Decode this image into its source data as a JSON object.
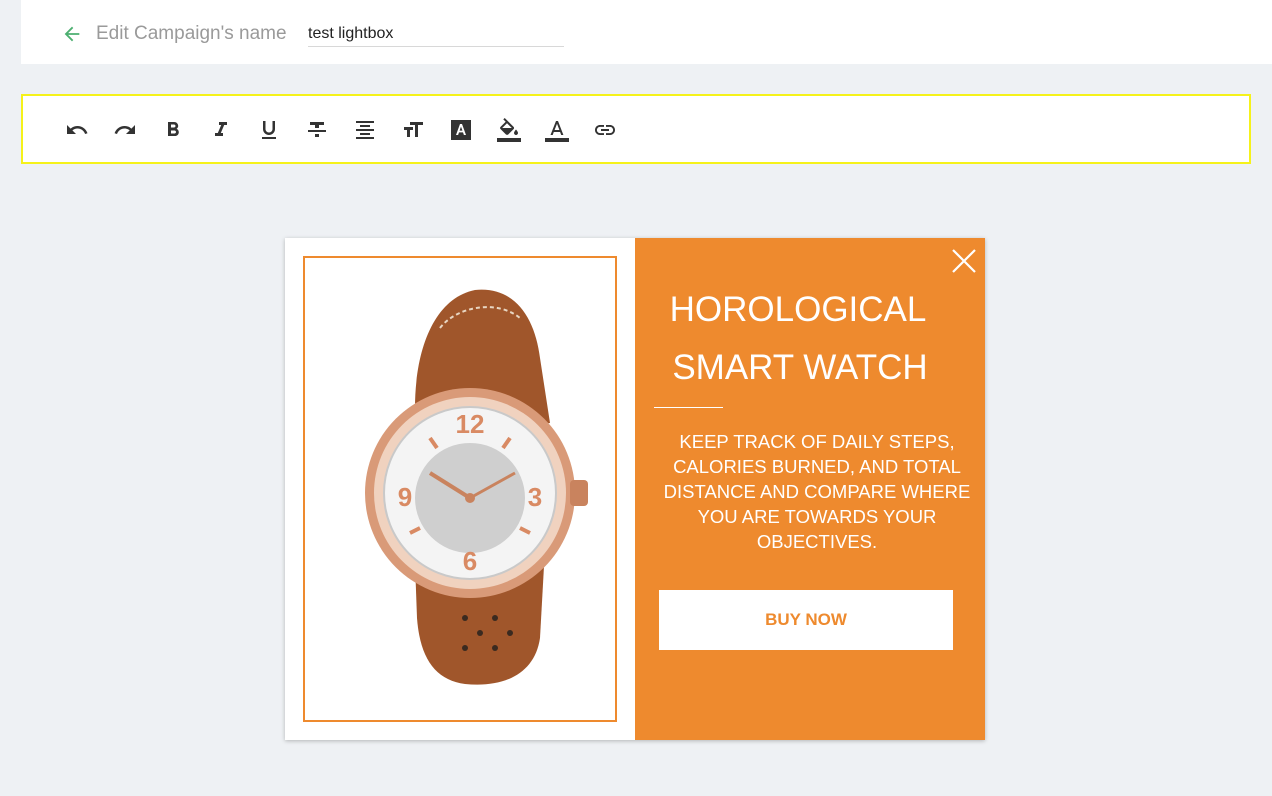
{
  "header": {
    "back_icon": "arrow-left-icon",
    "edit_label": "Edit Campaign's name",
    "campaign_name": "test lightbox"
  },
  "toolbar": {
    "accent": "#f5f21a",
    "tools": [
      {
        "name": "undo-icon"
      },
      {
        "name": "redo-icon"
      },
      {
        "name": "bold-icon"
      },
      {
        "name": "italic-icon"
      },
      {
        "name": "underline-icon"
      },
      {
        "name": "strikethrough-icon"
      },
      {
        "name": "align-center-icon"
      },
      {
        "name": "text-size-icon"
      },
      {
        "name": "text-background-icon"
      },
      {
        "name": "fill-color-icon"
      },
      {
        "name": "font-color-icon"
      },
      {
        "name": "link-icon"
      }
    ]
  },
  "popup": {
    "accent": "#ee8a2e",
    "headline_line1": "HOROLOGICAL",
    "headline_line2": "SMART WATCH",
    "body": "KEEP TRACK OF DAILY STEPS, CALORIES BURNED, AND TOTAL DISTANCE AND COMPARE WHERE YOU ARE TOWARDS YOUR OBJECTIVES.",
    "button_label": "BUY NOW",
    "close_icon": "close-icon",
    "image": "watch-product-image"
  }
}
